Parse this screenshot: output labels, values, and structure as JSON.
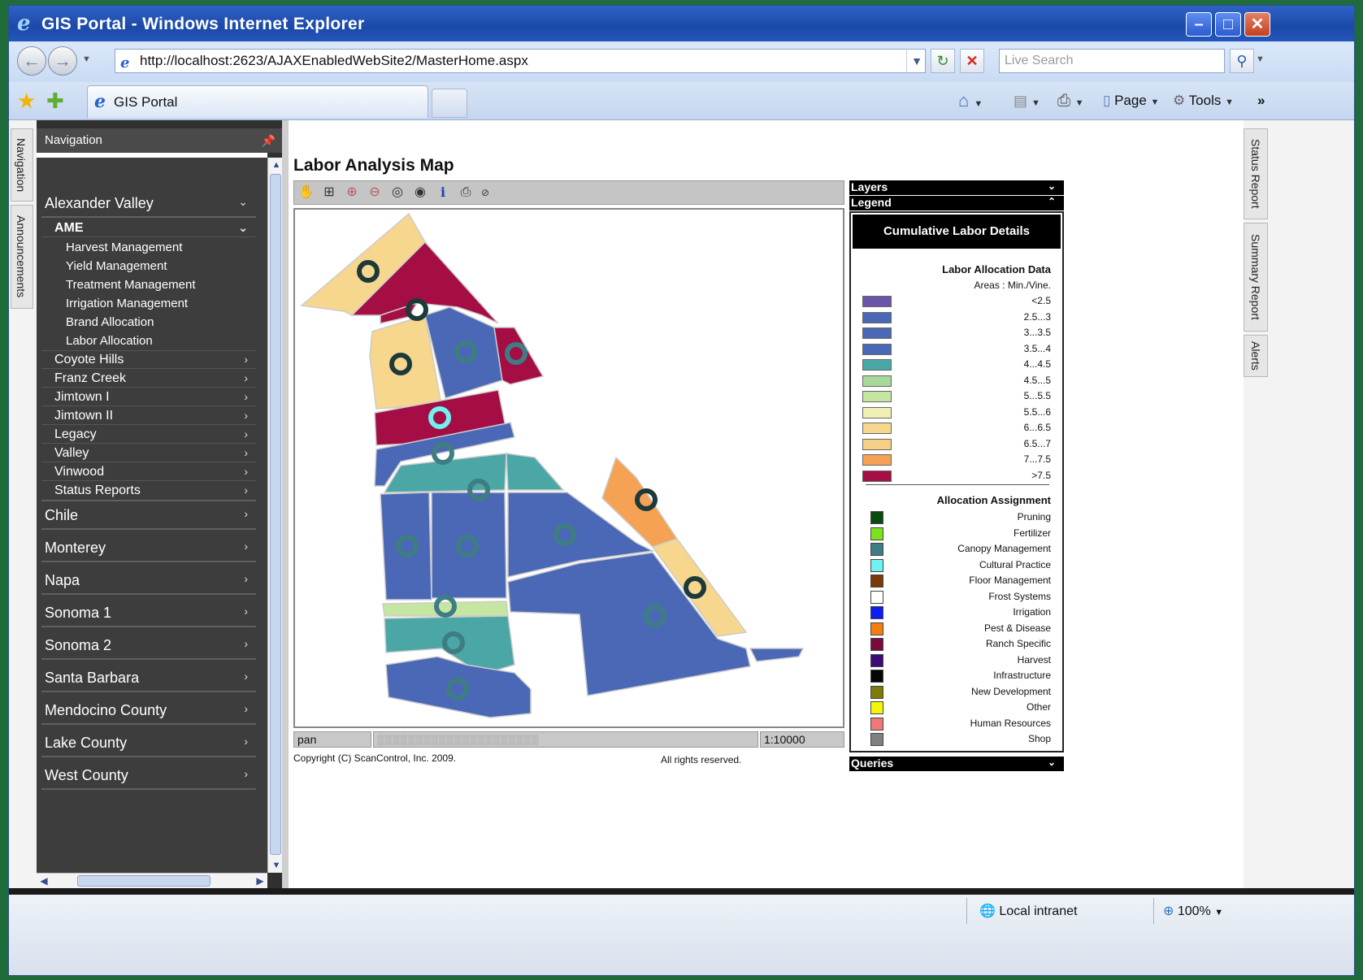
{
  "window": {
    "title": "GIS Portal - Windows Internet Explorer",
    "address": "http://localhost:2623/AJAXEnabledWebSite2/MasterHome.aspx",
    "search_placeholder": "Live Search",
    "tab_label": "GIS Portal",
    "commands": {
      "page": "Page",
      "tools": "Tools"
    }
  },
  "left_tabs": [
    "Navigation",
    "Announcements"
  ],
  "right_tabs": [
    "Status Report",
    "Summary Report",
    "Alerts"
  ],
  "nav": {
    "header": "Navigation",
    "groups": [
      {
        "label": "Alexander Valley",
        "expanded": true
      },
      {
        "label": "Chile"
      },
      {
        "label": "Monterey"
      },
      {
        "label": "Napa"
      },
      {
        "label": "Sonoma 1"
      },
      {
        "label": "Sonoma 2"
      },
      {
        "label": "Santa Barbara"
      },
      {
        "label": "Mendocino County"
      },
      {
        "label": "Lake County"
      },
      {
        "label": "West County"
      }
    ],
    "sub_groups": [
      {
        "label": "AME",
        "expanded": true
      },
      {
        "label": "Coyote Hills"
      },
      {
        "label": "Franz Creek"
      },
      {
        "label": "Jimtown I"
      },
      {
        "label": "Jimtown II"
      },
      {
        "label": "Legacy"
      },
      {
        "label": "Valley"
      },
      {
        "label": "Vinwood"
      },
      {
        "label": "Status Reports"
      }
    ],
    "ame_items": [
      "Harvest Management",
      "Yield Management",
      "Treatment Management",
      "Irrigation Management",
      "Brand Allocation",
      "Labor Allocation"
    ]
  },
  "map": {
    "title": "Labor Analysis Map",
    "mode": "pan",
    "scale": "1:10000",
    "copyright": "Copyright (C) ScanControl, Inc. 2009.",
    "rights": "All rights reserved."
  },
  "panels": {
    "layers": "Layers",
    "legend": "Legend",
    "queries": "Queries"
  },
  "legend": {
    "title": "Cumulative Labor Details",
    "data_heading": "Labor Allocation Data",
    "areas_label": "Areas : Min./Vine.",
    "ranges": [
      {
        "label": "<2.5",
        "color": "#6b55a8"
      },
      {
        "label": "2.5...3",
        "color": "#4a68b6"
      },
      {
        "label": "3...3.5",
        "color": "#4a68b6"
      },
      {
        "label": "3.5...4",
        "color": "#4a68b6"
      },
      {
        "label": "4...4.5",
        "color": "#4aa7a6"
      },
      {
        "label": "4.5...5",
        "color": "#a7d99a"
      },
      {
        "label": "5...5.5",
        "color": "#c4e6a1"
      },
      {
        "label": "5.5...6",
        "color": "#eef0b4"
      },
      {
        "label": "6...6.5",
        "color": "#f7d68d"
      },
      {
        "label": "6.5...7",
        "color": "#f6cf86"
      },
      {
        "label": "7...7.5",
        "color": "#f5a255"
      },
      {
        "label": ">7.5",
        "color": "#a50d45"
      }
    ],
    "assign_heading": "Allocation Assignment",
    "assignments": [
      {
        "label": "Pruning",
        "color": "#0a4a10"
      },
      {
        "label": "Fertilizer",
        "color": "#7be31c"
      },
      {
        "label": "Canopy Management",
        "color": "#3e7d84"
      },
      {
        "label": "Cultural Practice",
        "color": "#6ff2f2"
      },
      {
        "label": "Floor Management",
        "color": "#7b3a0a"
      },
      {
        "label": "Frost Systems",
        "color": "#ffffff"
      },
      {
        "label": "Irrigation",
        "color": "#0a1df2"
      },
      {
        "label": "Pest & Disease",
        "color": "#f57e14"
      },
      {
        "label": "Ranch Specific",
        "color": "#7b0a3c"
      },
      {
        "label": "Harvest",
        "color": "#3e0a78"
      },
      {
        "label": "Infrastructure",
        "color": "#050505"
      },
      {
        "label": "New Development",
        "color": "#7d7a0a"
      },
      {
        "label": "Other",
        "color": "#f5f50a"
      },
      {
        "label": "Human Resources",
        "color": "#f07878"
      },
      {
        "label": "Shop",
        "color": "#808080"
      }
    ]
  },
  "status_bar": {
    "zone": "Local intranet",
    "zoom": "100%"
  }
}
